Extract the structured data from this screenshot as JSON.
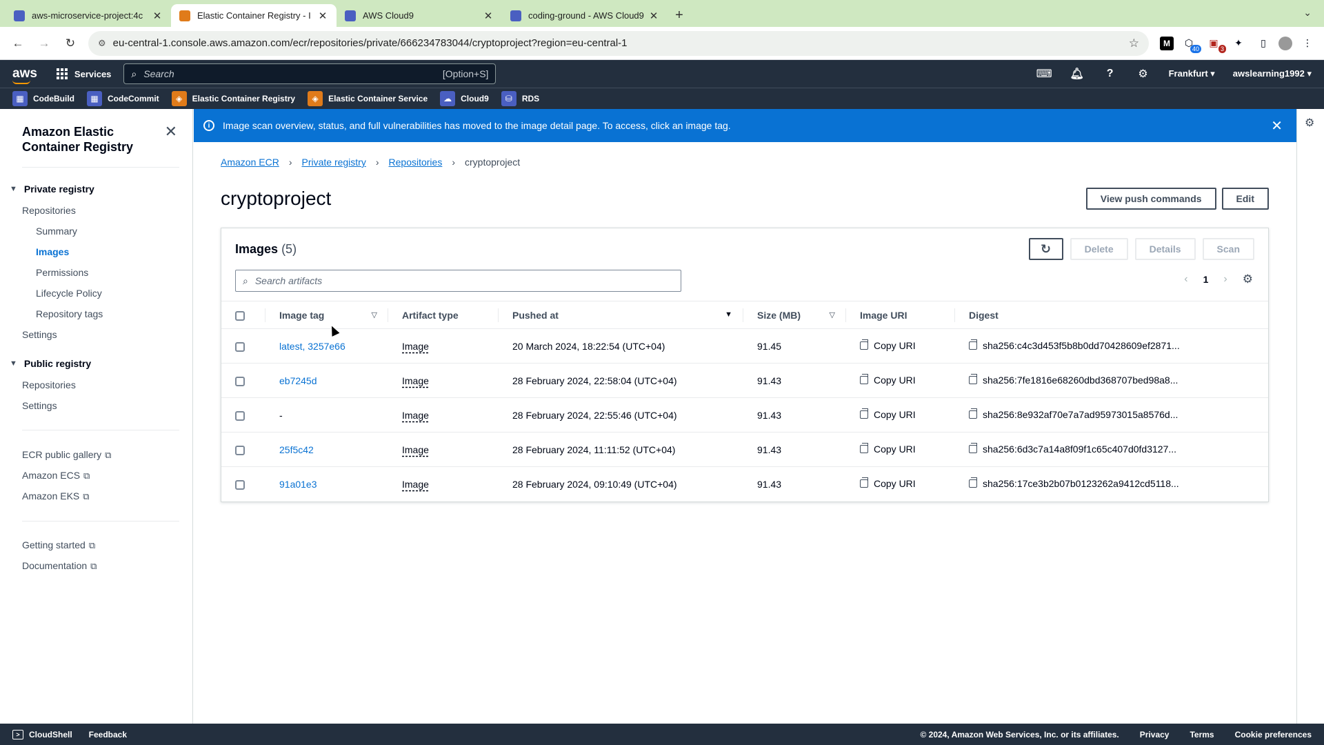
{
  "browser": {
    "tabs": [
      {
        "label": "aws-microservice-project:4c",
        "color": "#4a5fc1",
        "active": false
      },
      {
        "label": "Elastic Container Registry - I",
        "color": "#e07b1a",
        "active": true
      },
      {
        "label": "AWS Cloud9",
        "color": "#4a5fc1",
        "active": false
      },
      {
        "label": "coding-ground - AWS Cloud9",
        "color": "#4a5fc1",
        "active": false
      }
    ],
    "url": "eu-central-1.console.aws.amazon.com/ecr/repositories/private/666234783044/cryptoproject?region=eu-central-1",
    "ext_badge_1": "40",
    "ext_badge_2": "3"
  },
  "aws_nav": {
    "logo": "aws",
    "services": "Services",
    "search_placeholder": "Search",
    "search_shortcut": "[Option+S]",
    "region": "Frankfurt",
    "account": "awslearning1992"
  },
  "favorites": [
    {
      "label": "CodeBuild",
      "color": "#4a5fc1"
    },
    {
      "label": "CodeCommit",
      "color": "#4a5fc1"
    },
    {
      "label": "Elastic Container Registry",
      "color": "#e07b1a"
    },
    {
      "label": "Elastic Container Service",
      "color": "#e07b1a"
    },
    {
      "label": "Cloud9",
      "color": "#4a5fc1"
    },
    {
      "label": "RDS",
      "color": "#4a5fc1"
    }
  ],
  "sidenav": {
    "title": "Amazon Elastic Container Registry",
    "private_section": "Private registry",
    "private_repositories": "Repositories",
    "summary": "Summary",
    "images": "Images",
    "permissions": "Permissions",
    "lifecycle": "Lifecycle Policy",
    "repo_tags": "Repository tags",
    "private_settings": "Settings",
    "public_section": "Public registry",
    "public_repositories": "Repositories",
    "public_settings": "Settings",
    "gallery": "ECR public gallery",
    "ecs": "Amazon ECS",
    "eks": "Amazon EKS",
    "getting_started": "Getting started",
    "documentation": "Documentation"
  },
  "flash": {
    "message": "Image scan overview, status, and full vulnerabilities has moved to the image detail page. To access, click an image tag."
  },
  "breadcrumbs": {
    "b1": "Amazon ECR",
    "b2": "Private registry",
    "b3": "Repositories",
    "current": "cryptoproject"
  },
  "page": {
    "title": "cryptoproject",
    "view_push": "View push commands",
    "edit": "Edit"
  },
  "images_panel": {
    "title": "Images",
    "count": "(5)",
    "delete": "Delete",
    "details": "Details",
    "scan": "Scan",
    "search_placeholder": "Search artifacts",
    "page": "1",
    "columns": {
      "tag": "Image tag",
      "type": "Artifact type",
      "pushed": "Pushed at",
      "size": "Size (MB)",
      "uri": "Image URI",
      "digest": "Digest"
    },
    "rows": [
      {
        "tag": "latest, 3257e66",
        "type": "Image",
        "pushed": "20 March 2024, 18:22:54 (UTC+04)",
        "size": "91.45",
        "uri": "Copy URI",
        "digest": "sha256:c4c3d453f5b8b0dd70428609ef2871..."
      },
      {
        "tag": "eb7245d",
        "type": "Image",
        "pushed": "28 February 2024, 22:58:04 (UTC+04)",
        "size": "91.43",
        "uri": "Copy URI",
        "digest": "sha256:7fe1816e68260dbd368707bed98a8..."
      },
      {
        "tag": "-",
        "type": "Image",
        "pushed": "28 February 2024, 22:55:46 (UTC+04)",
        "size": "91.43",
        "uri": "Copy URI",
        "digest": "sha256:8e932af70e7a7ad95973015a8576d..."
      },
      {
        "tag": "25f5c42",
        "type": "Image",
        "pushed": "28 February 2024, 11:11:52 (UTC+04)",
        "size": "91.43",
        "uri": "Copy URI",
        "digest": "sha256:6d3c7a14a8f09f1c65c407d0fd3127..."
      },
      {
        "tag": "91a01e3",
        "type": "Image",
        "pushed": "28 February 2024, 09:10:49 (UTC+04)",
        "size": "91.43",
        "uri": "Copy URI",
        "digest": "sha256:17ce3b2b07b0123262a9412cd5118..."
      }
    ]
  },
  "footer": {
    "cloudshell": "CloudShell",
    "feedback": "Feedback",
    "copyright": "© 2024, Amazon Web Services, Inc. or its affiliates.",
    "privacy": "Privacy",
    "terms": "Terms",
    "cookies": "Cookie preferences"
  }
}
